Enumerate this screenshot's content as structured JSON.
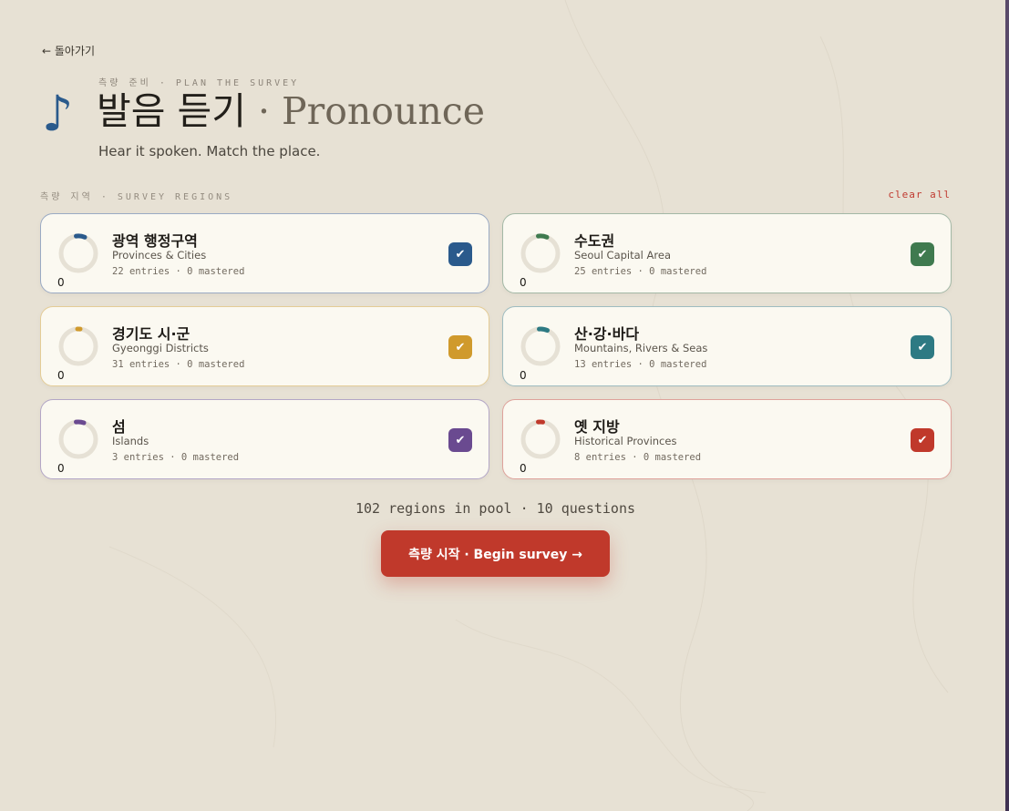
{
  "nav": {
    "back_label": "← 돌아가기"
  },
  "header": {
    "icon": "♪",
    "eyebrow": "측량 준비 · PLAN THE SURVEY",
    "title_ko": "발음 듣기",
    "title_sep": " · ",
    "title_en": "Pronounce",
    "subtitle": "Hear it spoken. Match the place."
  },
  "regions": {
    "label": "측량 지역 · SURVEY REGIONS",
    "clear_label": "clear all",
    "cards": [
      {
        "title": "광역 행정구역",
        "subtitle": "Provinces & Cities",
        "stats": "22 entries · 0 mastered",
        "count": "0",
        "color": "#2a5a8c",
        "border": "#9aaac4",
        "checked": true
      },
      {
        "title": "수도권",
        "subtitle": "Seoul Capital Area",
        "stats": "25 entries · 0 mastered",
        "count": "0",
        "color": "#3f7a4f",
        "border": "#a3b8a6",
        "checked": true
      },
      {
        "title": "경기도 시·군",
        "subtitle": "Gyeonggi Districts",
        "stats": "31 entries · 0 mastered",
        "count": "0",
        "color": "#d09a2c",
        "border": "#e4cc96",
        "checked": true
      },
      {
        "title": "산·강·바다",
        "subtitle": "Mountains, Rivers & Seas",
        "stats": "13 entries · 0 mastered",
        "count": "0",
        "color": "#2d7a83",
        "border": "#9ebcc0",
        "checked": true
      },
      {
        "title": "섬",
        "subtitle": "Islands",
        "stats": "3 entries · 0 mastered",
        "count": "0",
        "color": "#6a4a90",
        "border": "#b3a6c6",
        "checked": true
      },
      {
        "title": "옛 지방",
        "subtitle": "Historical Provinces",
        "stats": "8 entries · 0 mastered",
        "count": "0",
        "color": "#c0392b",
        "border": "#dea29b",
        "checked": true
      }
    ]
  },
  "footer": {
    "pool_info": "102 regions in pool · 10 questions",
    "begin_label": "측량 시작 · Begin survey →"
  }
}
